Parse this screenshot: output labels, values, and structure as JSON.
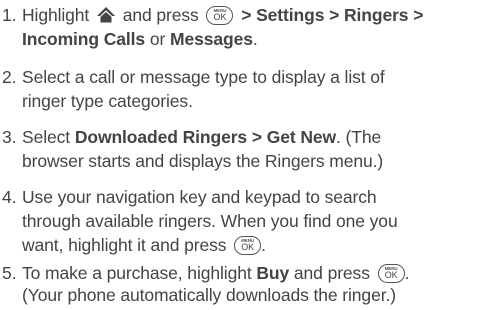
{
  "steps": [
    {
      "number": "1.",
      "parts": {
        "a": "Highlight",
        "b": "and press",
        "c": "> Settings > Ringers >",
        "d": "Incoming Calls",
        "e": "or",
        "f": "Messages",
        "g": "."
      }
    },
    {
      "number": "2.",
      "parts": {
        "a": "Select a call or message type to display a list of",
        "b": "ringer type categories."
      }
    },
    {
      "number": "3.",
      "parts": {
        "a": "Select",
        "b": "Downloaded Ringers > Get New",
        "c": ". (The",
        "d": "browser starts and displays the Ringers menu.)"
      }
    },
    {
      "number": "4.",
      "parts": {
        "a": "Use your navigation key and keypad to search",
        "b": "through available ringers. When you find one you",
        "c": "want, highlight it and press",
        "d": "."
      }
    },
    {
      "number": "5.",
      "parts": {
        "a": "To make a purchase, highlight",
        "b": "Buy",
        "c": "and press",
        "d": ".",
        "e": "(Your phone automatically downloads the ringer.)"
      }
    }
  ],
  "key": {
    "top": "MENU",
    "main": "OK"
  },
  "icons": {
    "home": "home-icon",
    "menu_ok": "menu-ok-key-icon"
  },
  "colors": {
    "text": "#444444"
  }
}
